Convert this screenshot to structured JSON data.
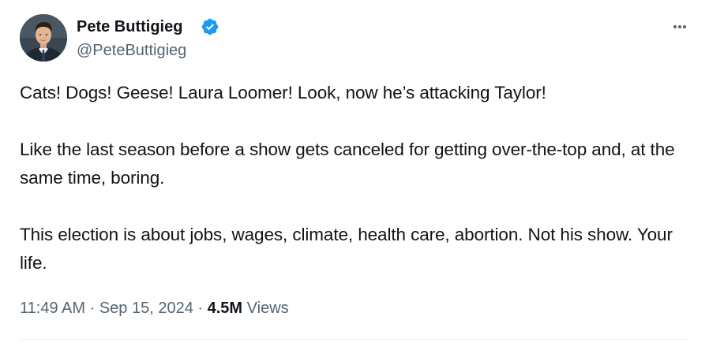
{
  "author": {
    "display_name": "Pete Buttigieg",
    "handle": "@PeteButtigieg",
    "verified": true,
    "avatar_icon": "profile-photo"
  },
  "more_icon": "more-horizontal-icon",
  "tweet": {
    "paragraphs": [
      "Cats! Dogs! Geese! Laura Loomer! Look, now he’s attacking Taylor!",
      "Like the last season before a show gets canceled for getting over-the-top and, at the same time, boring.",
      "This election is about jobs, wages, climate, health care, abortion. Not his show. Your life."
    ]
  },
  "meta": {
    "time": "11:49 AM",
    "date": "Sep 15, 2024",
    "separator": "·",
    "views_count": "4.5M",
    "views_label": "Views"
  },
  "colors": {
    "text_primary": "#0f1419",
    "text_secondary": "#536471",
    "verified_blue": "#1d9bf0",
    "divider": "#eff3f4"
  }
}
